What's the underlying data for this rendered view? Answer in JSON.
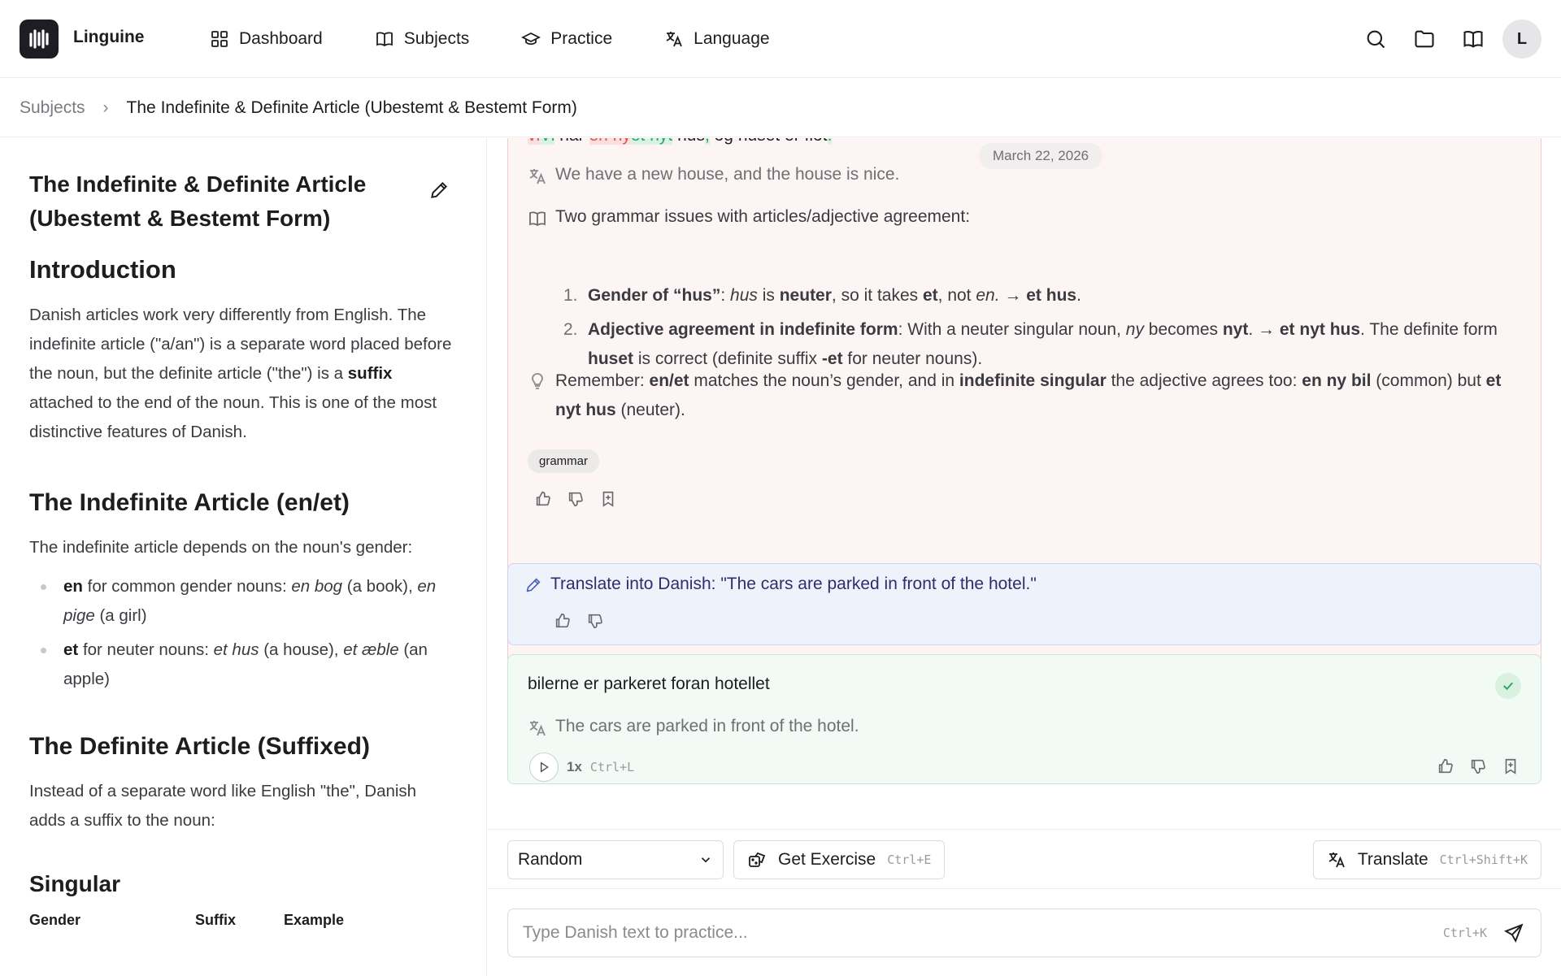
{
  "app": {
    "name": "Linguine",
    "avatar_initial": "L"
  },
  "nav": {
    "items": [
      {
        "label": "Dashboard",
        "icon": "grid-icon"
      },
      {
        "label": "Subjects",
        "icon": "book-icon"
      },
      {
        "label": "Practice",
        "icon": "graduation-cap-icon"
      },
      {
        "label": "Language",
        "icon": "translate-icon"
      }
    ],
    "right_icons": [
      "search-icon",
      "folder-icon",
      "book-open-icon"
    ]
  },
  "breadcrumb": {
    "root": "Subjects",
    "separator": "›",
    "current": "The Indefinite & Definite Article (Ubestemt & Bestemt Form)"
  },
  "lesson": {
    "title": "The Indefinite & Definite Article (Ubestemt & Bestemt Form)",
    "intro_heading": "Introduction",
    "intro_p1": "Danish articles work very differently from English. The indefinite article (\"a/an\") is a separate word placed before the noun, but the definite article (\"the\") is a",
    "intro_bold": "suffix",
    "intro_p2": "attached to the end of the noun. This is one of the most distinctive features of Danish.",
    "indef_heading": "The Indefinite Article (en/et)",
    "indef_p": "The indefinite article depends on the noun's gender:",
    "bullets": [
      {
        "bold": "en",
        "text1": "for common gender nouns:",
        "ex1": "en bog",
        "gloss1": "(a book),",
        "ex2": "en pige",
        "gloss2": "(a girl)"
      },
      {
        "bold": "et",
        "text1": "for neuter nouns:",
        "ex1": "et hus",
        "gloss1": "(a house),",
        "ex2": "et æble",
        "gloss2": "(an apple)"
      }
    ],
    "def_heading": "The Definite Article (Suffixed)",
    "def_p": "Instead of a separate word like English \"the\", Danish adds a suffix to the noun:",
    "singular_heading": "Singular",
    "table_headers": [
      "Gender",
      "Suffix",
      "Example"
    ]
  },
  "feed": {
    "date": "March 22, 2026",
    "correction": {
      "del_1": "vi",
      "ins_1": "Vi",
      "text_1": " har ",
      "del_2": "en ny",
      "ins_2": "et nyt",
      "text_2": " hus",
      "ins_3": ",",
      "text_3": " og huset er flot",
      "ins_4": ".",
      "translation": "We have a new house, and the house is nice.",
      "explanation": "Two grammar issues with articles/adjective agreement:",
      "points": [
        {
          "num": "1.",
          "html_parts": [
            "Gender of “hus”",
            ": ",
            "hus",
            " is ",
            "neuter",
            ", so it takes ",
            "et",
            ", not ",
            "en.",
            " → ",
            "et hus",
            "."
          ]
        },
        {
          "num": "2.",
          "html_parts": [
            "Adjective agreement in indefinite form",
            ": With a neuter singular noun, ",
            "ny",
            " becomes ",
            "nyt",
            ". → ",
            "et nyt hus",
            ". The definite form ",
            "huset",
            " is correct (definite suffix ",
            "-et",
            " for neuter nouns)."
          ]
        }
      ],
      "tip_parts": [
        "Remember: ",
        "en/et",
        " matches the noun’s gender, and in ",
        "indefinite singular",
        " the adjective agrees too: ",
        "en ny bil",
        " (common) but ",
        "et nyt hus",
        " (neuter)."
      ],
      "tag": "grammar"
    },
    "prompt": {
      "text": "Translate into Danish: \"The cars are parked in front of the hotel.\""
    },
    "answer": {
      "text": "bilerne er parkeret foran hotellet",
      "translation": "The cars are parked in front of the hotel.",
      "speed": "1x",
      "shortcut": "Ctrl+L"
    }
  },
  "toolbar": {
    "mode_selected": "Random",
    "get_exercise_label": "Get Exercise",
    "get_exercise_shortcut": "Ctrl+E",
    "translate_label": "Translate",
    "translate_shortcut": "Ctrl+Shift+K"
  },
  "composer": {
    "placeholder": "Type Danish text to practice...",
    "shortcut": "Ctrl+K"
  }
}
